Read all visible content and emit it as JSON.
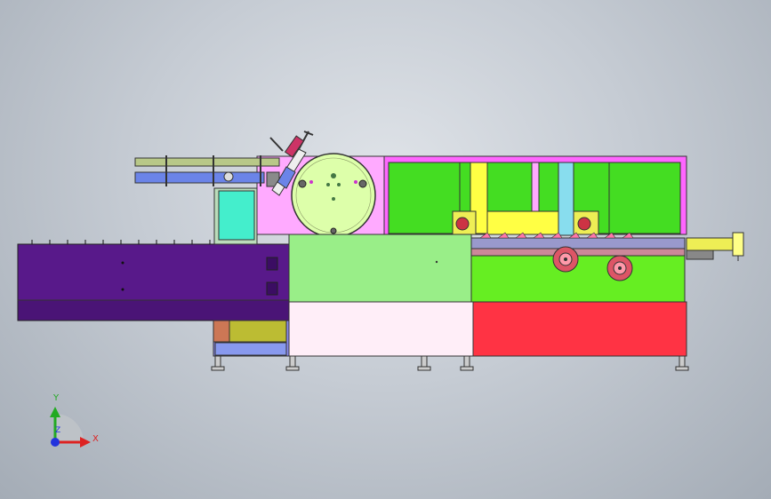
{
  "triad": {
    "x_label": "X",
    "y_label": "Y",
    "z_label": "Z"
  },
  "colors": {
    "viewport_top": "#dfe3e8",
    "viewport_bottom": "#a4acb6",
    "infeed_conveyor": "#58198a",
    "main_frame_upper": "#99ee88",
    "main_frame_lower_left": "#ffeef8",
    "main_frame_lower_right": "#ff3344",
    "guard_panels": "#44dd22",
    "magazine": "#ffaaff",
    "carousel": "#ddffaa",
    "cyan_block": "#44eecc",
    "outfeed": "#eeee55"
  }
}
